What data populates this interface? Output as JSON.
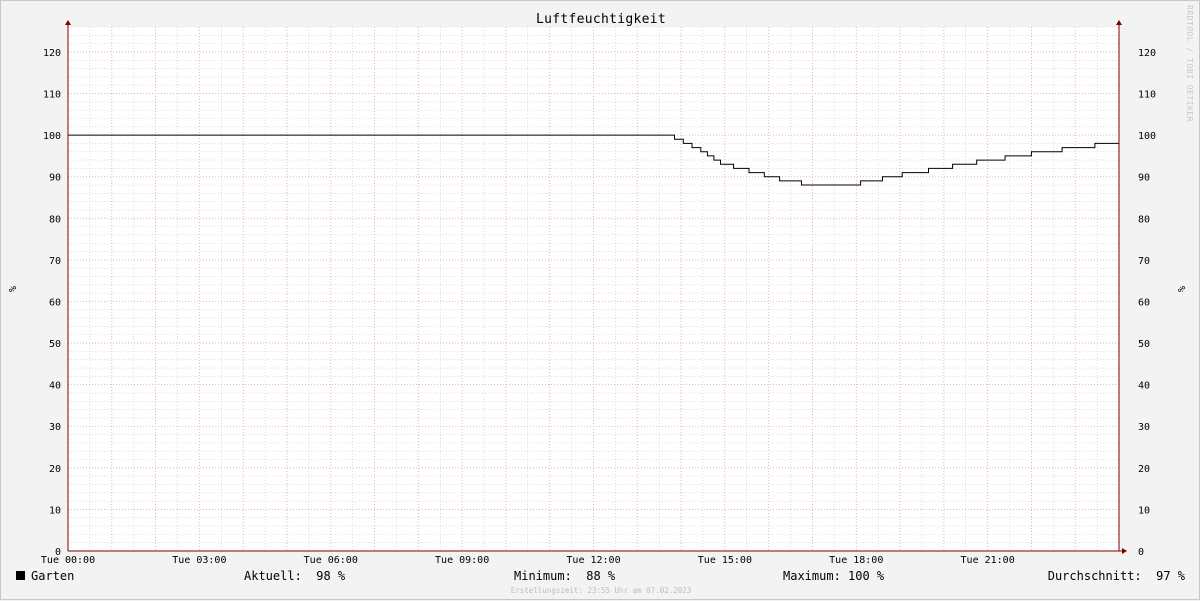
{
  "title": "Luftfeuchtigkeit",
  "watermark": "RRDTOOL / TOBI OETIKER",
  "footer": "Erstellungszeit: 23:55 Uhr am 07.02.2023",
  "chart_data": {
    "type": "line",
    "title": "Luftfeuchtigkeit",
    "ylabel": "%",
    "ylim": [
      0,
      126
    ],
    "y_ticks": [
      0,
      10,
      20,
      30,
      40,
      50,
      60,
      70,
      80,
      90,
      100,
      110,
      120
    ],
    "xlim": [
      0,
      24
    ],
    "x_ticks": [
      0,
      3,
      6,
      9,
      12,
      15,
      18,
      21
    ],
    "x_tick_labels": [
      "Tue 00:00",
      "Tue 03:00",
      "Tue 06:00",
      "Tue 09:00",
      "Tue 12:00",
      "Tue 15:00",
      "Tue 18:00",
      "Tue 21:00"
    ],
    "grid": true,
    "colors": {
      "background": "#ffffff",
      "major_grid": "#e6a0a0",
      "minor_grid": "#c8c8c8",
      "line": "#000000",
      "axis": "#800000"
    },
    "series": [
      {
        "name": "Garten",
        "color": "#000000",
        "x": [
          0,
          13.85,
          14.05,
          14.25,
          14.45,
          14.6,
          14.75,
          14.9,
          15.2,
          15.55,
          15.9,
          16.25,
          16.75,
          18.1,
          18.6,
          19.05,
          19.65,
          20.2,
          20.75,
          21.4,
          22.0,
          22.7,
          23.45,
          24.0
        ],
        "y": [
          100,
          99,
          98,
          97,
          96,
          95,
          94,
          93,
          92,
          91,
          90,
          89,
          88,
          89,
          90,
          91,
          92,
          93,
          94,
          95,
          96,
          97,
          98,
          98
        ]
      }
    ]
  },
  "legend": {
    "series": "Garten",
    "current": "Aktuell:  98 %",
    "minimum": "Minimum:  88 %",
    "maximum": "Maximum: 100 %",
    "average": "Durchschnitt:  97 %"
  }
}
